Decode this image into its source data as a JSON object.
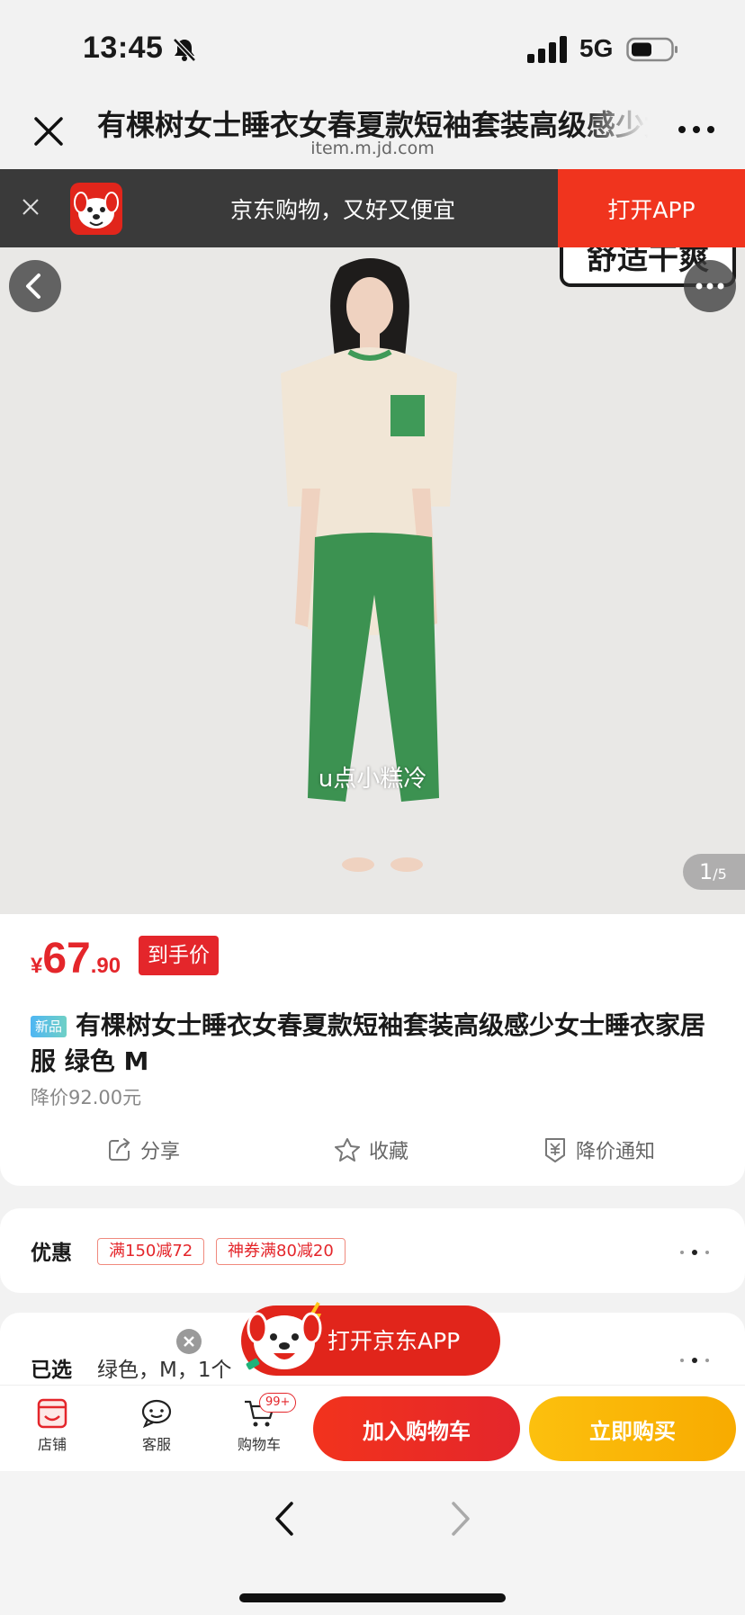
{
  "status_bar": {
    "time": "13:45",
    "network": "5G"
  },
  "browser": {
    "page_title": "有棵树女士睡衣女春夏款短袖套装高级感少女士睡衣家居服 绿色 M",
    "domain": "item.m.jd.com"
  },
  "app_banner": {
    "text": "京东购物，又好又便宜",
    "open_label": "打开APP"
  },
  "gallery": {
    "sticker_text": "舒适干爽",
    "watermark": "u点小糕冷",
    "current": "1",
    "total": "/5"
  },
  "product": {
    "price_currency": "¥",
    "price_int": "67",
    "price_dec": ".90",
    "price_tag": "到手价",
    "new_badge": "新品",
    "title": "有棵树女士睡衣女春夏款短袖套装高级感少女士睡衣家居服 绿色 M",
    "drop_price": "降价92.00元",
    "actions": {
      "share": "分享",
      "favorite": "收藏",
      "price_alert": "降价通知"
    }
  },
  "coupon": {
    "label": "优惠",
    "items": [
      "满150减72",
      "神券满80减20"
    ]
  },
  "selected": {
    "label": "已选",
    "value": "绿色，M，1个"
  },
  "floating": {
    "open_app": "打开京东APP"
  },
  "bottom_bar": {
    "store": "店铺",
    "service": "客服",
    "cart": "购物车",
    "cart_count": "99+",
    "add_to_cart": "加入购物车",
    "buy_now": "立即购买"
  },
  "colors": {
    "accent_red": "#e4262b",
    "buy_yellow": "#fcc00e",
    "banner_dark": "#3a3a3a"
  }
}
